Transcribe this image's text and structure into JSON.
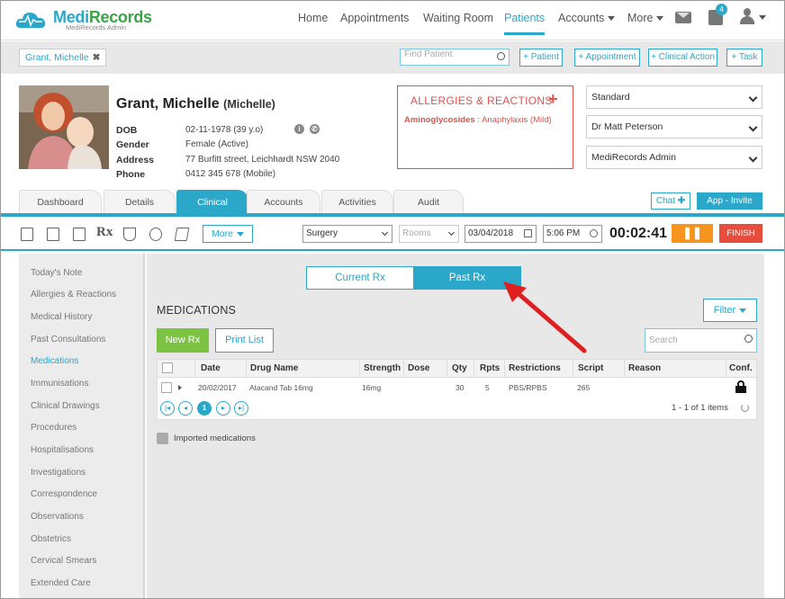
{
  "brand": {
    "name_part1": "Medi",
    "name_part2": "Records",
    "subtitle": "MediRecords Admin"
  },
  "nav": {
    "items": [
      "Home",
      "Appointments",
      "Waiting Room",
      "Patients",
      "Accounts",
      "More"
    ],
    "active": "Patients",
    "tasks_badge": "4"
  },
  "toolbar": {
    "patient_chip": "Grant, Michelle",
    "find_placeholder": "Find Patient",
    "buttons": [
      "+ Patient",
      "+ Appointment",
      "+ Clinical Action",
      "+ Task"
    ]
  },
  "patient": {
    "name": "Grant, Michelle",
    "preferred": "(Michelle)",
    "fields": [
      {
        "label": "DOB",
        "value": "02-11-1978 (39 y.o)"
      },
      {
        "label": "Gender",
        "value": "Female (Active)"
      },
      {
        "label": "Address",
        "value": "77 Burfitt street, Leichhardt NSW 2040"
      },
      {
        "label": "Phone",
        "value": "0412 345 678 (Mobile)"
      }
    ]
  },
  "allergies": {
    "title": "ALLERGIES & REACTIONS",
    "add": "+",
    "item_name": "Aminoglycosides",
    "item_detail": " : Anaphylaxis (Mild)"
  },
  "selects": [
    "Standard",
    "Dr Matt Peterson",
    "MediRecords Admin"
  ],
  "tabs": [
    "Dashboard",
    "Details",
    "Clinical",
    "Accounts",
    "Activities",
    "Audit"
  ],
  "active_tab": "Clinical",
  "header_buttons": {
    "chat": "Chat",
    "app_invite": "App - Invite"
  },
  "clinical_toolbar": {
    "rx": "Rx",
    "more": "More",
    "location": "Surgery",
    "rooms": "Rooms",
    "date": "03/04/2018",
    "time": "5:06 PM",
    "timer": "00:02:41",
    "pause": "❚❚",
    "finish": "FINISH"
  },
  "sidebar": {
    "items": [
      "Today's Note",
      "Allergies & Reactions",
      "Medical History",
      "Past Consultations",
      "Medications",
      "Immunisations",
      "Clinical Drawings",
      "Procedures",
      "Hospitalisations",
      "Investigations",
      "Correspondence",
      "Observations",
      "Obstetrics",
      "Cervical Smears",
      "Extended Care"
    ],
    "active": "Medications"
  },
  "medications": {
    "toggle": {
      "current": "Current Rx",
      "past": "Past Rx",
      "selected": "Past Rx"
    },
    "title": "MEDICATIONS",
    "filter": "Filter",
    "new_rx": "New Rx",
    "print_list": "Print List",
    "search_placeholder": "Search",
    "columns": [
      "Date",
      "Drug Name",
      "Strength",
      "Dose",
      "Qty",
      "Rpts",
      "Restrictions",
      "Script",
      "Reason",
      "Conf."
    ],
    "rows": [
      {
        "date": "20/02/2017",
        "drug": "Atacand Tab 16mg",
        "strength": "16mg",
        "dose": "",
        "qty": "30",
        "rpts": "5",
        "restrictions": "PBS/RPBS",
        "script": "265",
        "reason": ""
      }
    ],
    "pager": {
      "first": "|◂",
      "prev": "◂",
      "page": "1",
      "next": "▸",
      "last": "▸|"
    },
    "count": "1 - 1 of 1 items",
    "imported": "Imported medications"
  },
  "colors": {
    "accent": "#2aa7c9",
    "green": "#7dc243",
    "danger": "#e0524a",
    "orange": "#f7941d",
    "arrow": "#e02020"
  }
}
